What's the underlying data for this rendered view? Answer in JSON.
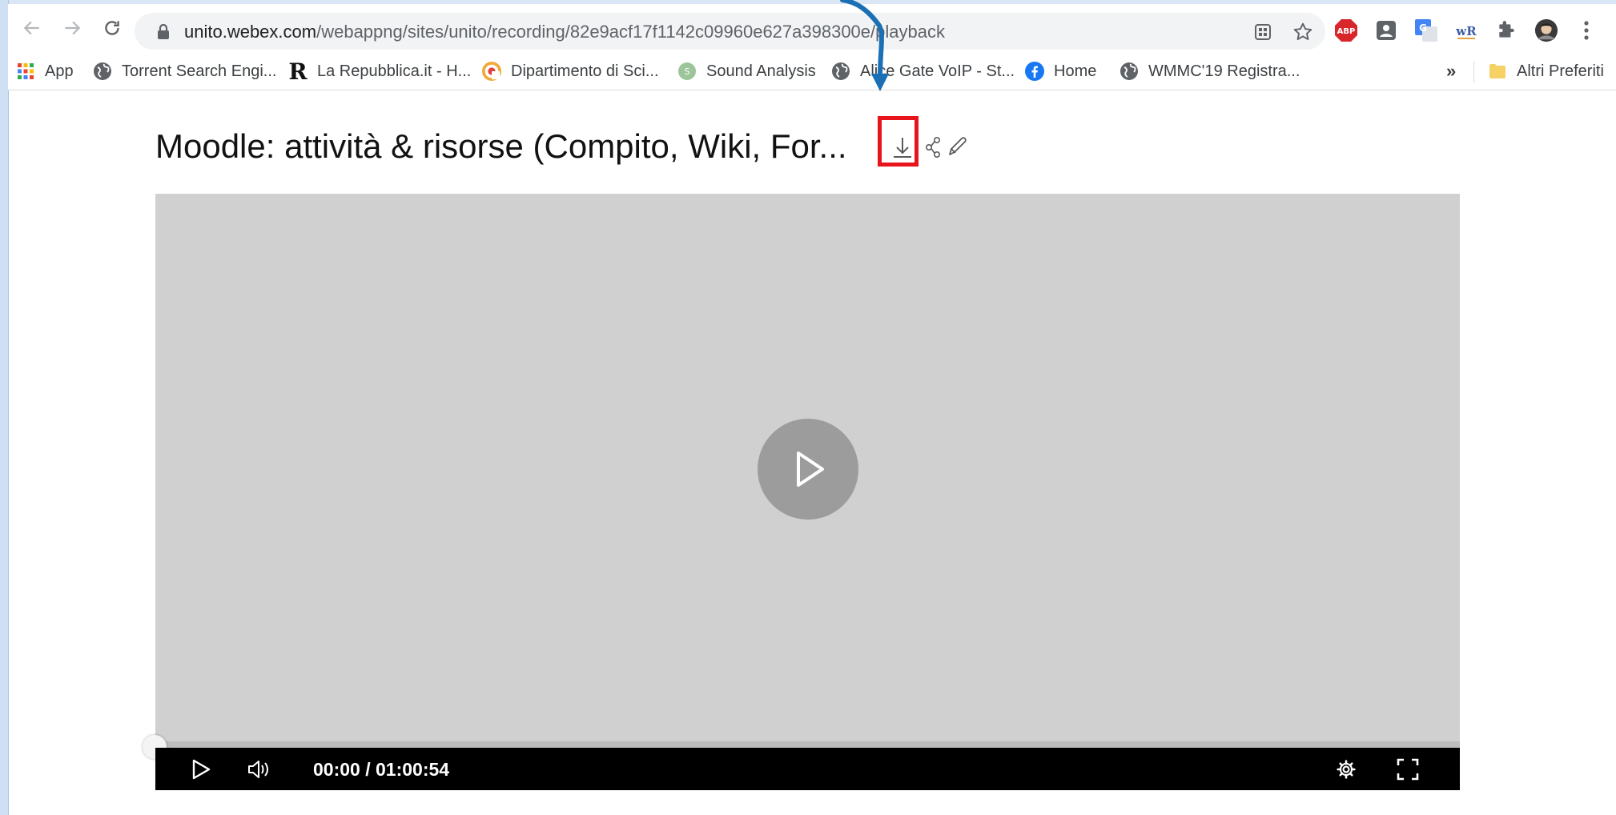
{
  "browser": {
    "url_host": "unito.webex.com",
    "url_path": "/webappng/sites/unito/recording/82e9acf17f1142c09960e627a398300e/playback",
    "extensions": [
      "ABP"
    ]
  },
  "bookmarks": {
    "items": [
      {
        "label": "App",
        "icon": "apps-grid-icon"
      },
      {
        "label": "Torrent Search Engi...",
        "icon": "globe-icon"
      },
      {
        "label": "La Repubblica.it - H...",
        "icon": "repubblica-r-icon"
      },
      {
        "label": "Dipartimento di Sci...",
        "icon": "dipartimento-icon"
      },
      {
        "label": "Sound Analysis",
        "icon": "sound-analysis-icon"
      },
      {
        "label": "Alice Gate VoIP - St...",
        "icon": "globe-icon"
      },
      {
        "label": "Home",
        "icon": "facebook-icon"
      },
      {
        "label": "WMMC'19 Registra...",
        "icon": "globe-icon"
      }
    ],
    "overflow": "»",
    "other_folder": "Altri Preferiti"
  },
  "page": {
    "title": "Moodle: attività & risorse (Compito, Wiki, For..."
  },
  "player": {
    "time": "00:00 / 01:00:54",
    "progress": 0
  },
  "colors": {
    "highlight": "#e8141b",
    "arrow": "#1a6fb5",
    "video_bg": "#d0d0d0",
    "controls_bg": "#000000"
  }
}
